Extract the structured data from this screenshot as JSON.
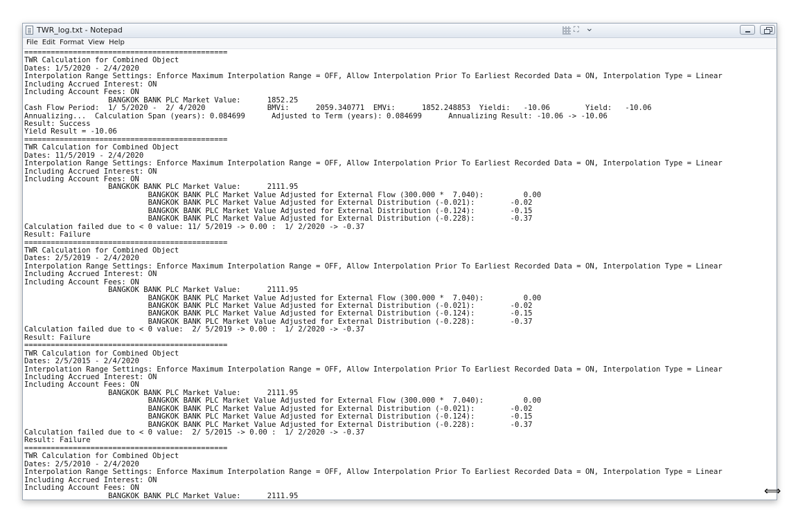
{
  "window": {
    "title": "TWR_log.txt - Notepad"
  },
  "menu": [
    "File",
    "Edit",
    "Format",
    "View",
    "Help"
  ],
  "icons": {
    "app": "notepad-icon",
    "snap": "snap-grid-icon",
    "expand": "expand-icon",
    "chevron": "chevron-down-icon",
    "minimize": "minimize-icon",
    "maximize": "restore-icon",
    "cursor": "resize-cursor-icon"
  },
  "glyphs": {
    "expand": "⛶",
    "chevron": "⌄",
    "cursor": "⟺"
  },
  "lines": [
    "==============================================",
    "TWR Calculation for Combined Object",
    "Dates: 1/5/2020 - 2/4/2020",
    "Interpolation Range Settings: Enforce Maximum Interpolation Range = OFF, Allow Interpolation Prior To Earliest Recorded Data = ON, Interpolation Type = Linear",
    "Including Accrued Interest: ON",
    "Including Account Fees: ON",
    "                   BANGKOK BANK PLC Market Value:      1852.25",
    "Cash Flow Period:  1/ 5/2020 -  2/ 4/2020              BMVi:      2059.340771  EMVi:      1852.248853  Yieldi:   -10.06        Yield:   -10.06",
    "Annualizing...  Calculation Span (years): 0.084699      Adjusted to Term (years): 0.084699      Annualizing Result: -10.06 -> -10.06",
    "Result: Success",
    "Yield Result = -10.06",
    "==============================================",
    "TWR Calculation for Combined Object",
    "Dates: 11/5/2019 - 2/4/2020",
    "Interpolation Range Settings: Enforce Maximum Interpolation Range = OFF, Allow Interpolation Prior To Earliest Recorded Data = ON, Interpolation Type = Linear",
    "Including Accrued Interest: ON",
    "Including Account Fees: ON",
    "                   BANGKOK BANK PLC Market Value:      2111.95",
    "                            BANGKOK BANK PLC Market Value Adjusted for External Flow (300.000 *  7.040):         0.00",
    "                            BANGKOK BANK PLC Market Value Adjusted for External Distribution (-0.021):        -0.02",
    "                            BANGKOK BANK PLC Market Value Adjusted for External Distribution (-0.124):        -0.15",
    "                            BANGKOK BANK PLC Market Value Adjusted for External Distribution (-0.228):        -0.37",
    "Calculation failed due to < 0 value: 11/ 5/2019 -> 0.00 :  1/ 2/2020 -> -0.37",
    "Result: Failure",
    "==============================================",
    "TWR Calculation for Combined Object",
    "Dates: 2/5/2019 - 2/4/2020",
    "Interpolation Range Settings: Enforce Maximum Interpolation Range = OFF, Allow Interpolation Prior To Earliest Recorded Data = ON, Interpolation Type = Linear",
    "Including Accrued Interest: ON",
    "Including Account Fees: ON",
    "                   BANGKOK BANK PLC Market Value:      2111.95",
    "                            BANGKOK BANK PLC Market Value Adjusted for External Flow (300.000 *  7.040):         0.00",
    "                            BANGKOK BANK PLC Market Value Adjusted for External Distribution (-0.021):        -0.02",
    "                            BANGKOK BANK PLC Market Value Adjusted for External Distribution (-0.124):        -0.15",
    "                            BANGKOK BANK PLC Market Value Adjusted for External Distribution (-0.228):        -0.37",
    "Calculation failed due to < 0 value:  2/ 5/2019 -> 0.00 :  1/ 2/2020 -> -0.37",
    "Result: Failure",
    "==============================================",
    "TWR Calculation for Combined Object",
    "Dates: 2/5/2015 - 2/4/2020",
    "Interpolation Range Settings: Enforce Maximum Interpolation Range = OFF, Allow Interpolation Prior To Earliest Recorded Data = ON, Interpolation Type = Linear",
    "Including Accrued Interest: ON",
    "Including Account Fees: ON",
    "                   BANGKOK BANK PLC Market Value:      2111.95",
    "                            BANGKOK BANK PLC Market Value Adjusted for External Flow (300.000 *  7.040):         0.00",
    "                            BANGKOK BANK PLC Market Value Adjusted for External Distribution (-0.021):        -0.02",
    "                            BANGKOK BANK PLC Market Value Adjusted for External Distribution (-0.124):        -0.15",
    "                            BANGKOK BANK PLC Market Value Adjusted for External Distribution (-0.228):        -0.37",
    "Calculation failed due to < 0 value:  2/ 5/2015 -> 0.00 :  1/ 2/2020 -> -0.37",
    "Result: Failure",
    "==============================================",
    "TWR Calculation for Combined Object",
    "Dates: 2/5/2010 - 2/4/2020",
    "Interpolation Range Settings: Enforce Maximum Interpolation Range = OFF, Allow Interpolation Prior To Earliest Recorded Data = ON, Interpolation Type = Linear",
    "Including Accrued Interest: ON",
    "Including Account Fees: ON",
    "                   BANGKOK BANK PLC Market Value:      2111.95"
  ]
}
